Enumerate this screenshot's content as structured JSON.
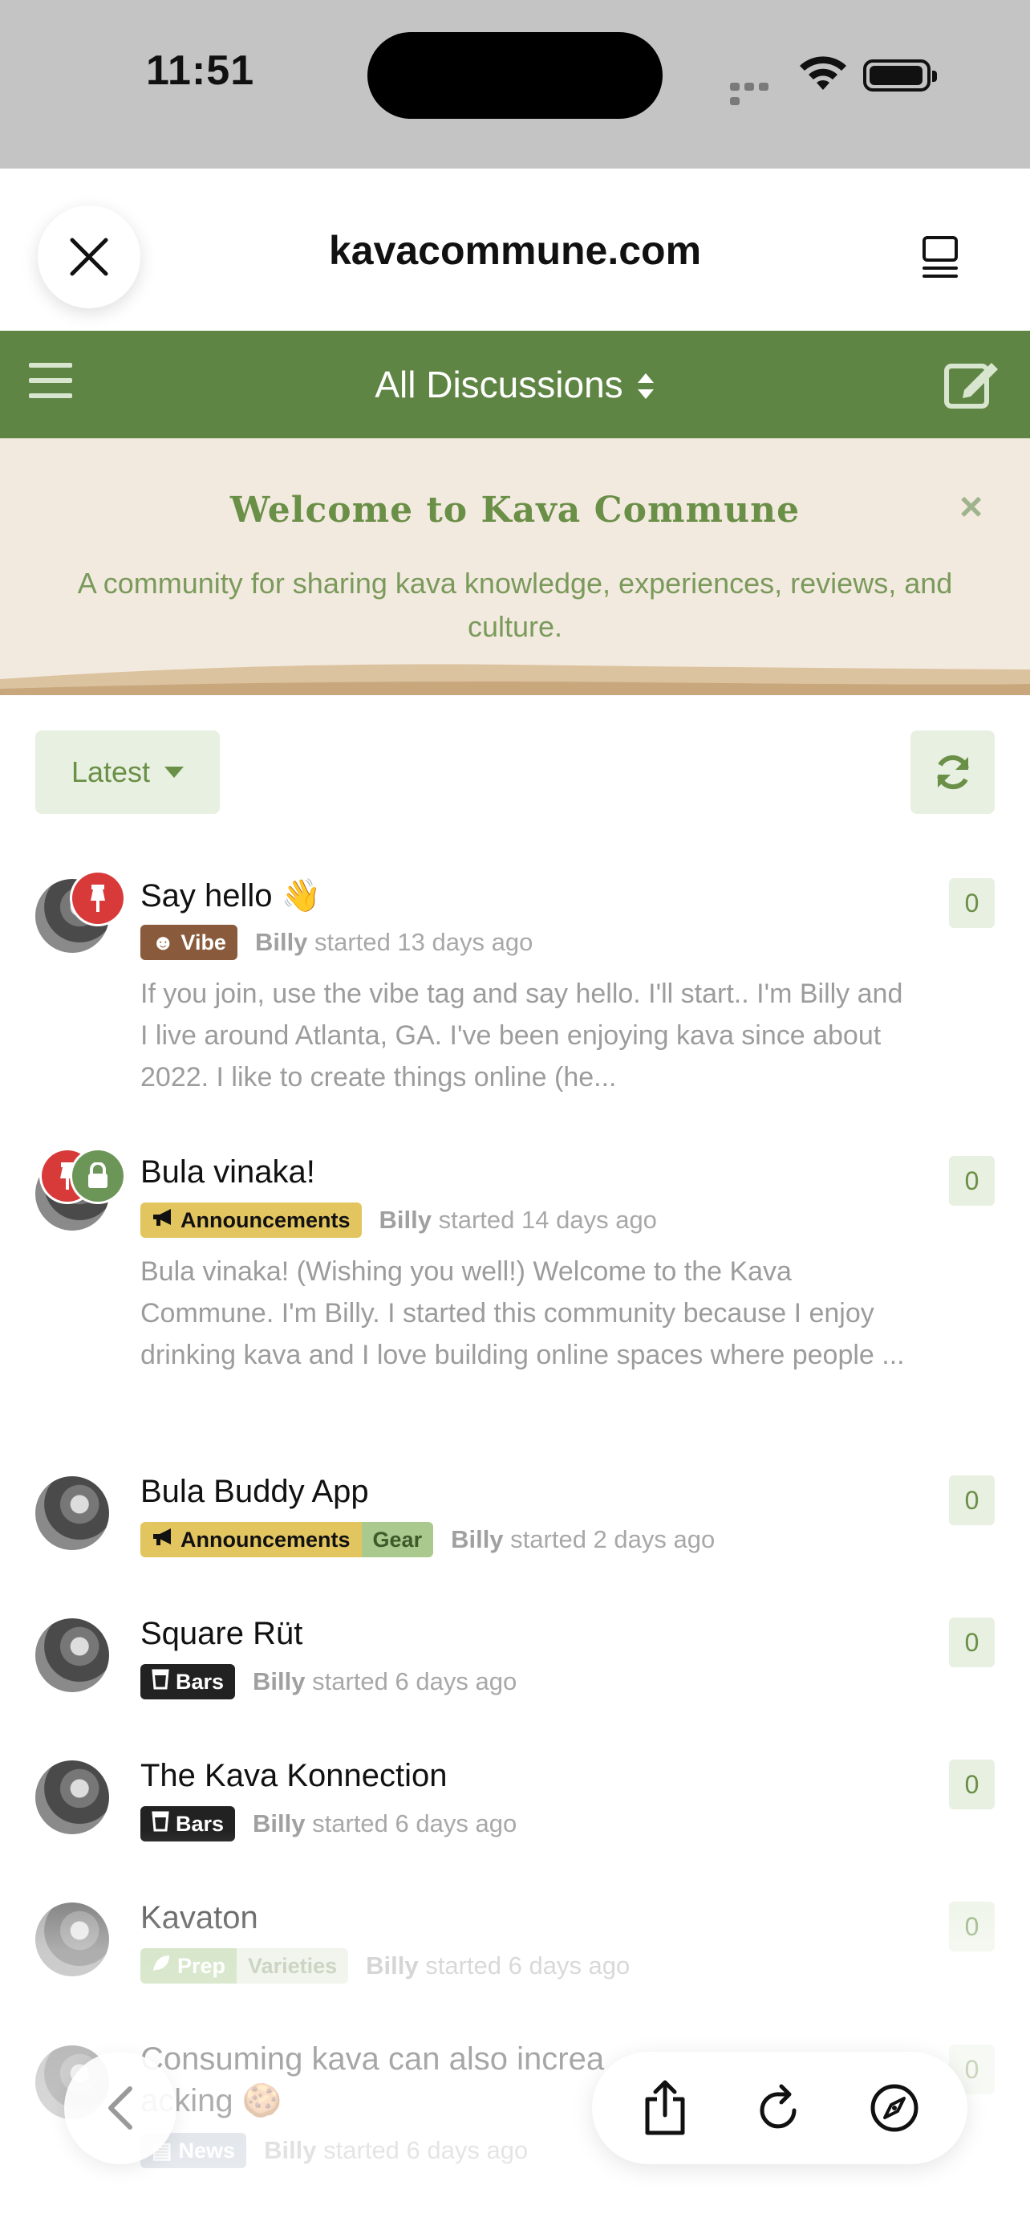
{
  "status_bar": {
    "time": "11:51"
  },
  "browser": {
    "domain": "kavacommune.com"
  },
  "nav": {
    "title": "All Discussions"
  },
  "hero": {
    "title": "Welcome to Kava Commune",
    "subtitle": "A community for sharing kava knowledge, experiences, reviews, and culture."
  },
  "controls": {
    "sort_label": "Latest"
  },
  "discussions": [
    {
      "title": "Say hello 👋",
      "tags": [
        "Vibe"
      ],
      "author": "Billy",
      "started": "started 13 days ago",
      "excerpt": "If you join, use the vibe tag and say hello. I'll start.. I'm Billy and I live around Atlanta, GA. I've been enjoying kava since about 2022. I like to create things online (he...",
      "count": "0"
    },
    {
      "title": "Bula vinaka!",
      "tags": [
        "Announcements"
      ],
      "author": "Billy",
      "started": "started 14 days ago",
      "excerpt": "Bula vinaka! (Wishing you well!) Welcome to the Kava Commune. I'm Billy. I started this community because I enjoy drinking kava and I love building online spaces where people ...",
      "count": "0"
    },
    {
      "title": "Bula Buddy App",
      "tags": [
        "Announcements",
        "Gear"
      ],
      "author": "Billy",
      "started": "started 2 days ago",
      "count": "0"
    },
    {
      "title": "Square Rüt",
      "tags": [
        "Bars"
      ],
      "author": "Billy",
      "started": "started 6 days ago",
      "count": "0"
    },
    {
      "title": "The Kava Konnection",
      "tags": [
        "Bars"
      ],
      "author": "Billy",
      "started": "started 6 days ago",
      "count": "0"
    },
    {
      "title": "Kavaton",
      "tags": [
        "Prep",
        "Varieties"
      ],
      "author": "Billy",
      "started": "started 6 days ago",
      "count": "0"
    },
    {
      "title_line1": "Consuming kava can also increa",
      "title_line2": "acking 🍪",
      "tags": [
        "News"
      ],
      "author": "Billy",
      "started": "started 6 days ago",
      "count": "0"
    }
  ],
  "colors": {
    "nav_green": "#5f8544",
    "hero_bg": "#f3eadf",
    "accent_green": "#6a8f47",
    "pin_red": "#d83a3a",
    "tag_vibe": "#8a5a3c",
    "tag_announcements": "#e3c560",
    "tag_gear": "#a9c98e",
    "tag_bars": "#222222"
  },
  "icons": [
    "close-icon",
    "tabs-icon",
    "menu-icon",
    "sort-caret-icon",
    "compose-icon",
    "refresh-icon",
    "pin-icon",
    "lock-icon",
    "megaphone-icon",
    "beer-glass-icon",
    "leaf-icon",
    "newspaper-icon",
    "smiley-icon",
    "back-chevron-icon",
    "share-icon",
    "reload-icon",
    "compass-icon"
  ]
}
